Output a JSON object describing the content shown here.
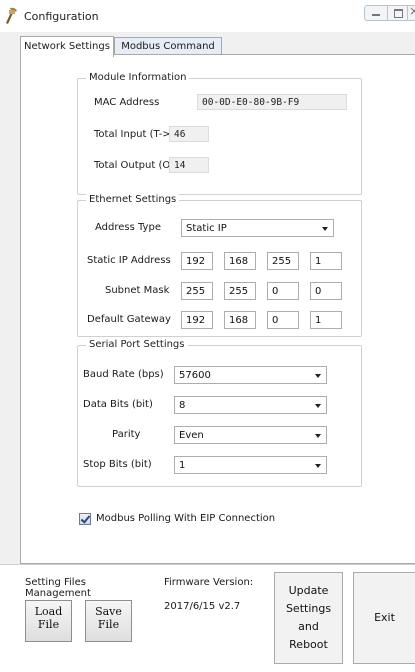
{
  "window": {
    "title": "Configuration"
  },
  "tabs": {
    "network": "Network Settings",
    "modbus": "Modbus Command"
  },
  "module": {
    "legend": "Module Information",
    "mac_label": "MAC Address",
    "mac_value": "00-0D-E0-80-9B-F9",
    "input_label": "Total Input  (T->O)",
    "input_value": "46",
    "output_label": "Total Output (O->T)",
    "output_value": "14"
  },
  "ethernet": {
    "legend": "Ethernet Settings",
    "address_type_label": "Address Type",
    "address_type_value": "Static IP",
    "static_ip_label": "Static IP Address",
    "static_ip": [
      "192",
      "168",
      "255",
      "1"
    ],
    "subnet_label": "Subnet Mask",
    "subnet": [
      "255",
      "255",
      "0",
      "0"
    ],
    "gateway_label": "Default Gateway",
    "gateway": [
      "192",
      "168",
      "0",
      "1"
    ]
  },
  "serial": {
    "legend": "Serial Port Settings",
    "baud_label": "Baud Rate (bps)",
    "baud_value": "57600",
    "data_bits_label": "Data Bits (bit)",
    "data_bits_value": "8",
    "parity_label": "Parity",
    "parity_value": "Even",
    "stop_bits_label": "Stop Bits (bit)",
    "stop_bits_value": "1"
  },
  "polling": {
    "label": "Modbus Polling With EIP Connection",
    "checked": true
  },
  "bottom": {
    "files_label_1": "Setting Files",
    "files_label_2": "Management",
    "load_1": "Load",
    "load_2": "File",
    "save_1": "Save",
    "save_2": "File",
    "firmware_label": "Firmware Version:",
    "firmware_value": "2017/6/15 v2.7",
    "update_1": "Update",
    "update_2": "Settings",
    "update_3": "and",
    "update_4": "Reboot",
    "exit": "Exit"
  }
}
